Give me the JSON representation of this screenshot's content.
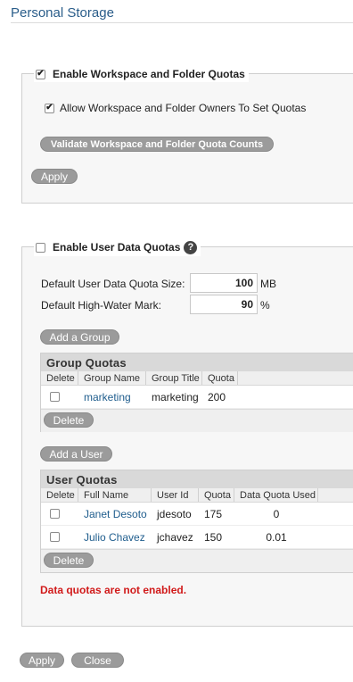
{
  "page": {
    "title": "Personal Storage"
  },
  "workspace_quotas": {
    "enable_label": "Enable Workspace and Folder Quotas",
    "enabled": true,
    "allow_owners_label": "Allow Workspace and Folder Owners To Set Quotas",
    "allow_owners": true,
    "validate_button": "Validate Workspace and Folder Quota Counts",
    "apply_button": "Apply"
  },
  "user_quotas": {
    "enable_label": "Enable User Data Quotas",
    "enabled": false,
    "help_icon": "?",
    "default_size_label": "Default User Data Quota Size:",
    "default_size_value": "100",
    "default_size_unit": "MB",
    "high_water_label": "Default High-Water Mark:",
    "high_water_value": "90",
    "high_water_unit": "%",
    "add_group_button": "Add a Group",
    "group_table": {
      "title": "Group Quotas",
      "columns": [
        "Delete",
        "Group Name",
        "Group Title",
        "Quota"
      ],
      "rows": [
        {
          "group_name": "marketing",
          "group_title": "marketing",
          "quota": "200"
        }
      ],
      "delete_button": "Delete"
    },
    "add_user_button": "Add a User",
    "user_table": {
      "title": "User Quotas",
      "columns": [
        "Delete",
        "Full Name",
        "User Id",
        "Quota",
        "Data Quota Used"
      ],
      "rows": [
        {
          "full_name": "Janet Desoto",
          "user_id": "jdesoto",
          "quota": "175",
          "used": "0"
        },
        {
          "full_name": "Julio Chavez",
          "user_id": "jchavez",
          "quota": "150",
          "used": "0.01"
        }
      ],
      "delete_button": "Delete"
    },
    "error_message": "Data quotas are not enabled."
  },
  "footer": {
    "apply_button": "Apply",
    "close_button": "Close"
  },
  "colors": {
    "title": "#2a5d8a",
    "link": "#1f5d8d",
    "error": "#d11a1a",
    "button": "#9b9b9b"
  }
}
